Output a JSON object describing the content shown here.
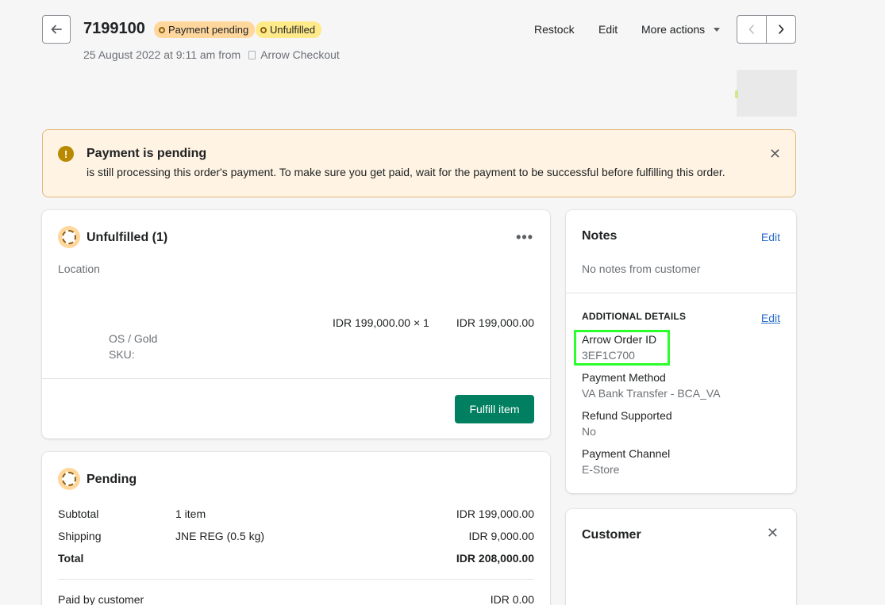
{
  "header": {
    "order_number": "7199100",
    "badges": {
      "payment": "Payment pending",
      "fulfillment": "Unfulfilled"
    },
    "meta_date": "25 August 2022 at 9:11 am from",
    "meta_source": "Arrow Checkout",
    "actions": {
      "restock": "Restock",
      "edit": "Edit",
      "more": "More actions"
    }
  },
  "banner": {
    "title": "Payment is pending",
    "text": "is still processing this order's payment. To make sure you get paid, wait for the payment to be successful before fulfilling this order.",
    "icon": "exclamation-icon"
  },
  "unfulfilled": {
    "title": "Unfulfilled (1)",
    "location_label": "Location",
    "item": {
      "unit_price": "IDR 199,000.00 × 1",
      "total": "IDR 199,000.00",
      "variant": "OS / Gold",
      "sku": "SKU:"
    },
    "fulfill_button": "Fulfill item"
  },
  "pending": {
    "title": "Pending",
    "rows": [
      {
        "label": "Subtotal",
        "detail": "1 item",
        "amount": "IDR 199,000.00"
      },
      {
        "label": "Shipping",
        "detail": "JNE REG (0.5 kg)",
        "amount": "IDR 9,000.00"
      },
      {
        "label": "Total",
        "detail": "",
        "amount": "IDR 208,000.00"
      }
    ],
    "paid_label": "Paid by customer",
    "paid_amount": "IDR 0.00"
  },
  "notes": {
    "title": "Notes",
    "edit": "Edit",
    "empty": "No notes from customer",
    "additional_title": "ADDITIONAL DETAILS",
    "additional_edit": "Edit",
    "details": [
      {
        "label": "Arrow Order ID",
        "value": "3EF1C700"
      },
      {
        "label": "Payment Method",
        "value": "VA Bank Transfer - BCA_VA"
      },
      {
        "label": "Refund Supported",
        "value": "No"
      },
      {
        "label": "Payment Channel",
        "value": "E-Store"
      }
    ]
  },
  "customer": {
    "title": "Customer"
  },
  "colors": {
    "primary_button": "#008060",
    "warning_bg": "#fff4e4",
    "badge_payment": "#ffd79d",
    "badge_fulfillment": "#ffea8a",
    "link": "#2c6ecb",
    "highlight": "#2bff2b"
  }
}
